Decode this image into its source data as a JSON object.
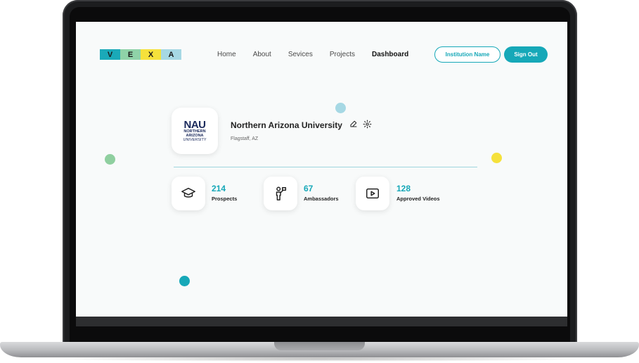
{
  "logo": {
    "letters": [
      "V",
      "E",
      "X",
      "A"
    ],
    "colors": [
      "#1aa9b8",
      "#8fd3a8",
      "#f5e13b",
      "#a6d8e4"
    ]
  },
  "nav": {
    "items": [
      "Home",
      "About",
      "Sevices",
      "Projects",
      "Dashboard"
    ],
    "active": "Dashboard"
  },
  "header": {
    "institution_button": "Institution Name",
    "signout_button": "Sign Out"
  },
  "profile": {
    "logo_lines": [
      "NAU",
      "NORTHERN",
      "ARIZONA",
      "UNIVERSITY"
    ],
    "name": "Northern Arizona University",
    "location": "Flagstaff, AZ"
  },
  "stats": [
    {
      "value": "214",
      "label": "Prospects",
      "icon": "graduation-cap-icon"
    },
    {
      "value": "67",
      "label": "Ambassadors",
      "icon": "presenter-icon"
    },
    {
      "value": "128",
      "label": "Approved Videos",
      "icon": "play-video-icon"
    }
  ],
  "colors": {
    "accent": "#16a8b8",
    "dot_blue": "#a6d8e4",
    "dot_green": "#8fcf9f",
    "dot_yellow": "#f5e13b",
    "dot_teal": "#16a8b8"
  }
}
